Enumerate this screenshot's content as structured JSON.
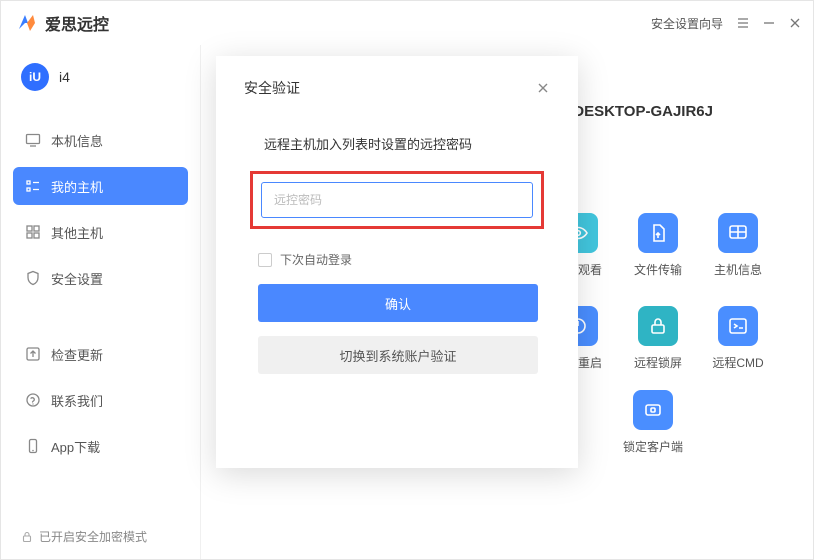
{
  "app": {
    "title": "爱思远控"
  },
  "titlebar": {
    "wizard": "安全设置向导"
  },
  "user": {
    "name": "i4",
    "avatar_text": "iU"
  },
  "sidebar": {
    "items": [
      {
        "label": "本机信息"
      },
      {
        "label": "我的主机"
      },
      {
        "label": "其他主机"
      },
      {
        "label": "安全设置"
      },
      {
        "label": "检查更新"
      },
      {
        "label": "联系我们"
      },
      {
        "label": "App下载"
      }
    ],
    "footer": "已开启安全加密模式"
  },
  "host": {
    "name": "DESKTOP-GAJIR6J"
  },
  "actions": {
    "items": [
      {
        "label": "远程观看"
      },
      {
        "label": "文件传输"
      },
      {
        "label": "主机信息"
      },
      {
        "label": "远程重启"
      },
      {
        "label": "远程锁屏"
      },
      {
        "label": "远程CMD"
      }
    ],
    "lock_client": "锁定客户端"
  },
  "modal": {
    "title": "安全验证",
    "subtitle": "远程主机加入列表时设置的远控密码",
    "placeholder": "远控密码",
    "auto_login": "下次自动登录",
    "confirm": "确认",
    "switch": "切换到系统账户验证"
  }
}
